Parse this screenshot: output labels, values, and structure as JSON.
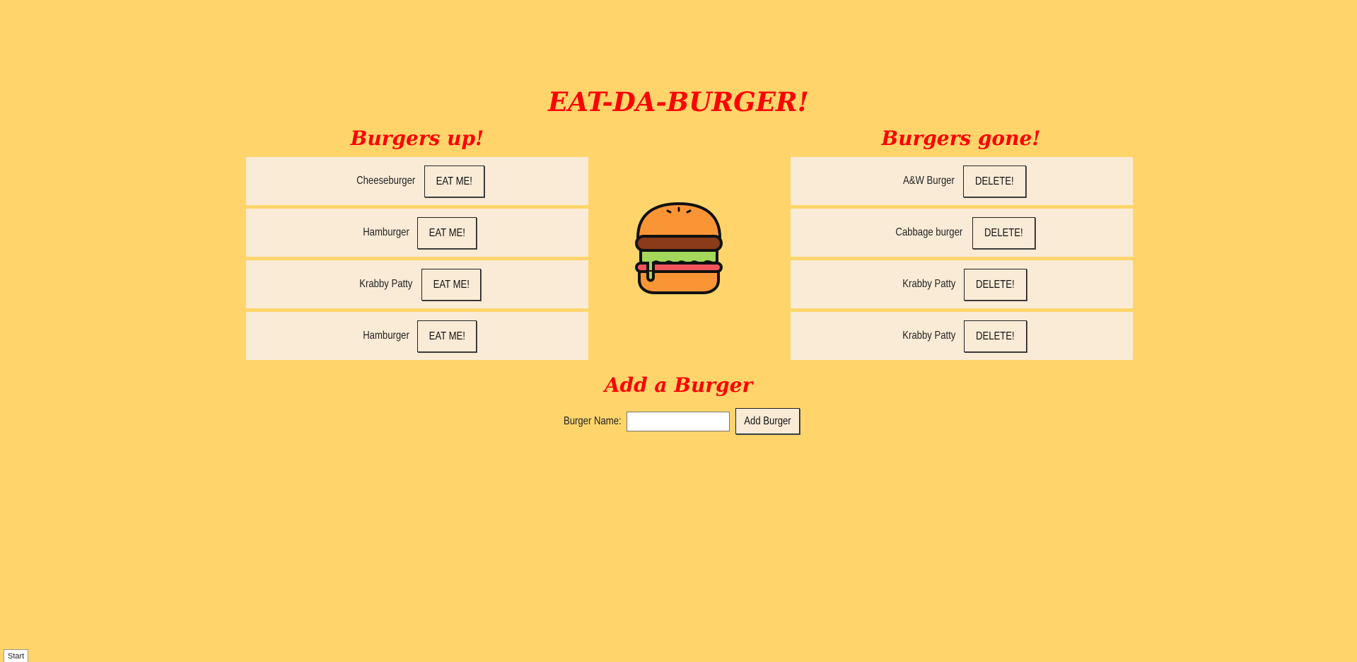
{
  "title": "EAT-DA-BURGER!",
  "burgers_up": {
    "heading": "Burgers up!",
    "button_label": "EAT ME!",
    "items": [
      {
        "name": "Cheeseburger"
      },
      {
        "name": "Hamburger"
      },
      {
        "name": "Krabby Patty"
      },
      {
        "name": "Hamburger"
      }
    ]
  },
  "burgers_gone": {
    "heading": "Burgers gone!",
    "button_label": "DELETE!",
    "items": [
      {
        "name": "A&W Burger"
      },
      {
        "name": "Cabbage burger"
      },
      {
        "name": "Krabby Patty"
      },
      {
        "name": "Krabby Patty"
      }
    ]
  },
  "center_image": {
    "icon": "burger-icon"
  },
  "add_form": {
    "heading": "Add a Burger",
    "label": "Burger Name:",
    "input_value": "",
    "input_placeholder": "",
    "submit_label": "Add Burger"
  },
  "taskbar": {
    "start_label": "Start"
  },
  "colors": {
    "background": "#ffd56b",
    "heading": "#ff0000",
    "row_background": "#faebd7"
  }
}
